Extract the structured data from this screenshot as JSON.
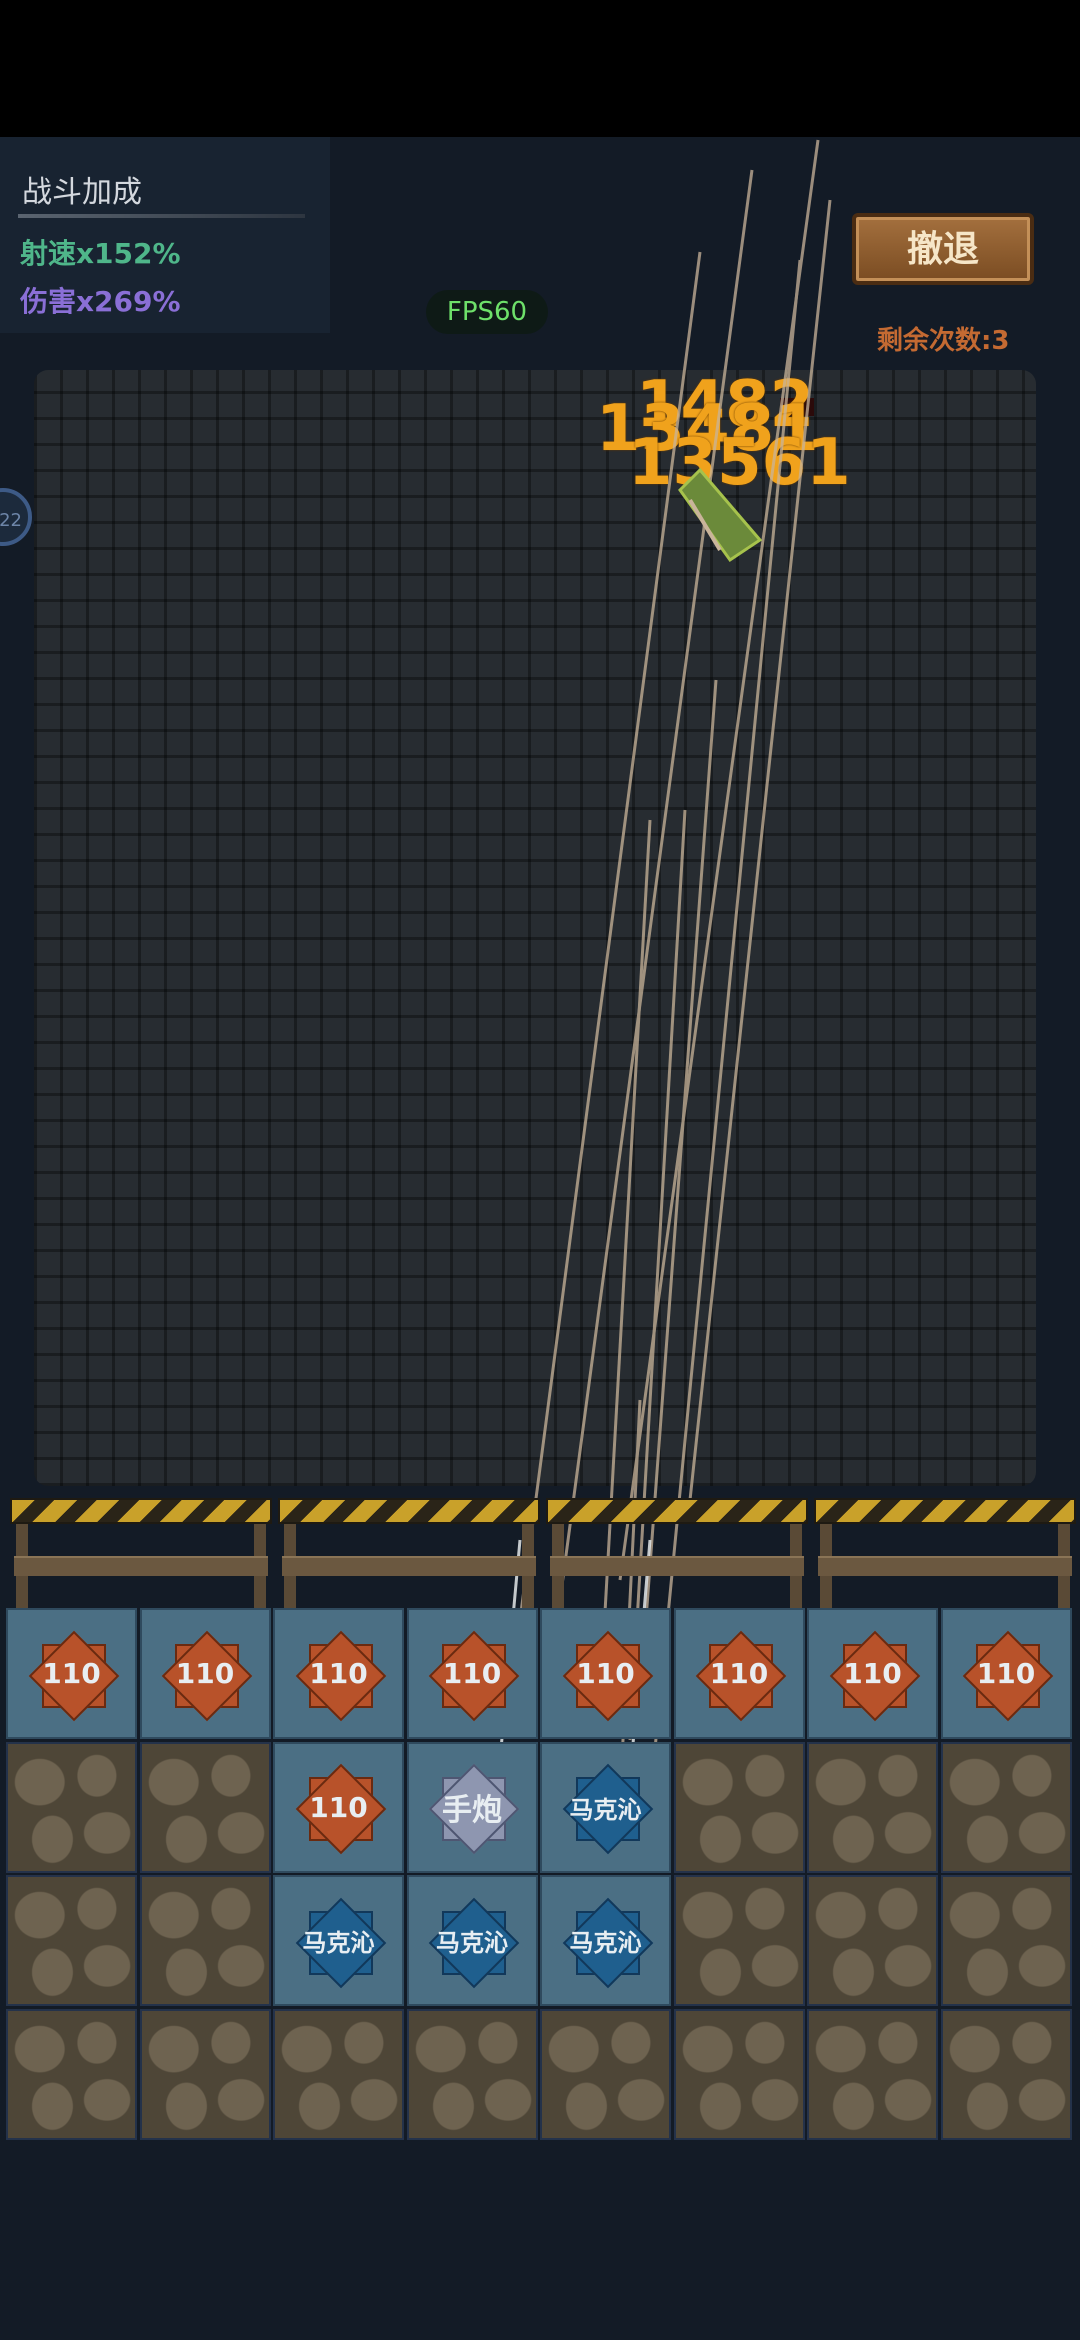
{
  "bonus": {
    "title": "战斗加成",
    "fire_rate": "射速x152%",
    "damage": "伤害x269%"
  },
  "fps": "FPS60",
  "retreat": {
    "label": "撤退",
    "remaining": "剩余次数:3"
  },
  "side_badge": "22",
  "damage_numbers": [
    "1482",
    "13481",
    "13561"
  ],
  "colors": {
    "fire_rate": "#4fb68a",
    "damage": "#8a6fd6",
    "fps": "#6ee06a",
    "damage_number": "#f0a21c",
    "remaining": "#c46a32"
  },
  "grid": {
    "rows": [
      [
        {
          "type": "slot",
          "gem": "orange",
          "label": "110"
        },
        {
          "type": "slot",
          "gem": "orange",
          "label": "110"
        },
        {
          "type": "slot",
          "gem": "orange",
          "label": "110"
        },
        {
          "type": "slot",
          "gem": "orange",
          "label": "110"
        },
        {
          "type": "slot",
          "gem": "orange",
          "label": "110"
        },
        {
          "type": "slot",
          "gem": "orange",
          "label": "110"
        },
        {
          "type": "slot",
          "gem": "orange",
          "label": "110"
        },
        {
          "type": "slot",
          "gem": "orange",
          "label": "110"
        }
      ],
      [
        {
          "type": "rock"
        },
        {
          "type": "rock"
        },
        {
          "type": "slot",
          "gem": "orange",
          "label": "110"
        },
        {
          "type": "slot",
          "gem": "silver",
          "label": "手炮"
        },
        {
          "type": "slot",
          "gem": "blue",
          "label": "马克沁"
        },
        {
          "type": "rock"
        },
        {
          "type": "rock"
        },
        {
          "type": "rock"
        }
      ],
      [
        {
          "type": "rock"
        },
        {
          "type": "rock"
        },
        {
          "type": "slot",
          "gem": "blue",
          "label": "马克沁"
        },
        {
          "type": "slot",
          "gem": "blue",
          "label": "马克沁"
        },
        {
          "type": "slot",
          "gem": "blue",
          "label": "马克沁"
        },
        {
          "type": "rock"
        },
        {
          "type": "rock"
        },
        {
          "type": "rock"
        }
      ],
      [
        {
          "type": "rock"
        },
        {
          "type": "rock"
        },
        {
          "type": "rock"
        },
        {
          "type": "rock"
        },
        {
          "type": "rock"
        },
        {
          "type": "rock"
        },
        {
          "type": "rock"
        },
        {
          "type": "rock"
        }
      ]
    ]
  }
}
